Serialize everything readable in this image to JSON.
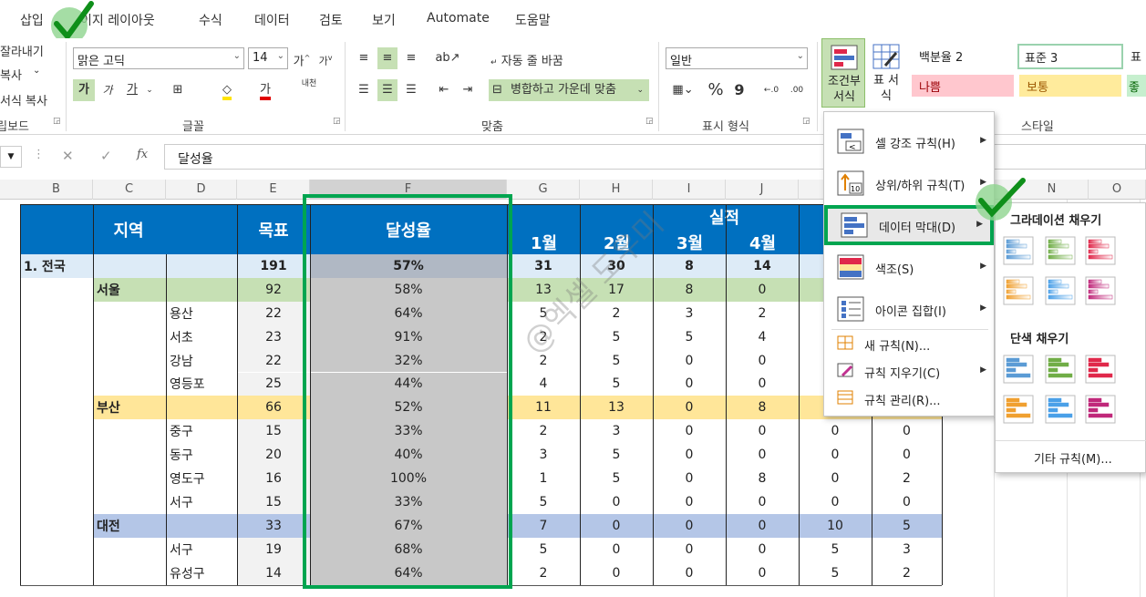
{
  "tabs": [
    "삽입",
    "이지 레이아웃",
    "수식",
    "데이터",
    "검토",
    "보기",
    "Automate",
    "도움말"
  ],
  "clipboard": {
    "cut": "잘라내기",
    "copy": "복사",
    "format_painter": "서식 복사",
    "label": "클립보드"
  },
  "font": {
    "name": "맑은 고딕",
    "size": "14",
    "label": "글꼴",
    "grow": "가",
    "shrink": "가",
    "bold": "가",
    "italic": "가",
    "underline": "가",
    "color": "가",
    "phonetic": "내천"
  },
  "alignment": {
    "wrap": "자동 줄 바꿈",
    "merge": "병합하고 가운데 맞춤",
    "label": "맞춤"
  },
  "number": {
    "format": "일반",
    "label": "표시 형식",
    "percent": "%",
    "comma": "9",
    "inc": "←.0",
    "dec": ".00"
  },
  "styles": {
    "cond_format": "조건부 서식",
    "table_format": "표 서식",
    "label": "스타일",
    "cells": [
      {
        "name": "백분율 2",
        "bg": "#ffffff",
        "color": "#222222"
      },
      {
        "name": "표준 3",
        "bg": "#ffffff",
        "color": "#222222"
      },
      {
        "name": "표",
        "bg": "#ffffff",
        "color": "#222222"
      },
      {
        "name": "나쁨",
        "bg": "#ffc7ce",
        "color": "#9c0006"
      },
      {
        "name": "보통",
        "bg": "#ffeb9c",
        "color": "#9c5700"
      },
      {
        "name": "좋",
        "bg": "#c6efce",
        "color": "#006100"
      }
    ]
  },
  "formula_bar": {
    "cell_ref": "",
    "fx": "fx",
    "content": "달성율"
  },
  "columns": [
    "B",
    "C",
    "D",
    "E",
    "F",
    "G",
    "H",
    "I",
    "J",
    "N",
    "O"
  ],
  "table": {
    "header": {
      "region": "지역",
      "target": "목표",
      "rate": "달성율",
      "actual": "실적",
      "months": [
        "1월",
        "2월",
        "3월",
        "4월"
      ]
    },
    "rows": [
      {
        "type": "total",
        "c1": "1. 전국",
        "c2": "",
        "target": "191",
        "rate": "57%",
        "m": [
          "31",
          "30",
          "8",
          "14"
        ],
        "k": "",
        "l": ""
      },
      {
        "type": "city",
        "c1": "",
        "c2": "서울",
        "target": "92",
        "rate": "58%",
        "m": [
          "13",
          "17",
          "8",
          "0"
        ],
        "k": "",
        "l": ""
      },
      {
        "type": "dist",
        "c1": "",
        "c2": "용산",
        "target": "22",
        "rate": "64%",
        "m": [
          "5",
          "2",
          "3",
          "2"
        ],
        "k": "",
        "l": ""
      },
      {
        "type": "dist",
        "c1": "",
        "c2": "서초",
        "target": "23",
        "rate": "91%",
        "m": [
          "2",
          "5",
          "5",
          "4"
        ],
        "k": "",
        "l": ""
      },
      {
        "type": "dist",
        "c1": "",
        "c2": "강남",
        "target": "22",
        "rate": "32%",
        "m": [
          "2",
          "5",
          "0",
          "0"
        ],
        "k": "",
        "l": ""
      },
      {
        "type": "dist",
        "c1": "",
        "c2": "영등포",
        "target": "25",
        "rate": "44%",
        "m": [
          "4",
          "5",
          "0",
          "0"
        ],
        "k": "",
        "l": ""
      },
      {
        "type": "city2",
        "c1": "",
        "c2": "부산",
        "target": "66",
        "rate": "52%",
        "m": [
          "11",
          "13",
          "0",
          "8"
        ],
        "k": "",
        "l": ""
      },
      {
        "type": "dist",
        "c1": "",
        "c2": "중구",
        "target": "15",
        "rate": "33%",
        "m": [
          "2",
          "3",
          "0",
          "0"
        ],
        "k": "0",
        "l": "0"
      },
      {
        "type": "dist",
        "c1": "",
        "c2": "동구",
        "target": "20",
        "rate": "40%",
        "m": [
          "3",
          "5",
          "0",
          "0"
        ],
        "k": "0",
        "l": "0"
      },
      {
        "type": "dist",
        "c1": "",
        "c2": "영도구",
        "target": "16",
        "rate": "100%",
        "m": [
          "1",
          "5",
          "0",
          "8"
        ],
        "k": "0",
        "l": "2"
      },
      {
        "type": "dist",
        "c1": "",
        "c2": "서구",
        "target": "15",
        "rate": "33%",
        "m": [
          "5",
          "0",
          "0",
          "0"
        ],
        "k": "0",
        "l": "0"
      },
      {
        "type": "city3",
        "c1": "",
        "c2": "대전",
        "target": "33",
        "rate": "67%",
        "m": [
          "7",
          "0",
          "0",
          "0"
        ],
        "k": "10",
        "l": "5"
      },
      {
        "type": "dist",
        "c1": "",
        "c2": "서구",
        "target": "19",
        "rate": "68%",
        "m": [
          "5",
          "0",
          "0",
          "0"
        ],
        "k": "5",
        "l": "3"
      },
      {
        "type": "dist",
        "c1": "",
        "c2": "유성구",
        "target": "14",
        "rate": "64%",
        "m": [
          "2",
          "0",
          "0",
          "0"
        ],
        "k": "5",
        "l": "2"
      }
    ]
  },
  "cf_menu": [
    {
      "label": "셀 강조 규칙(H)",
      "icon": "highlight-rules-icon",
      "sub": true
    },
    {
      "label": "상위/하위 규칙(T)",
      "icon": "top-bottom-icon",
      "sub": true
    },
    {
      "label": "데이터 막대(D)",
      "icon": "data-bars-icon",
      "sub": true,
      "highlight": true
    },
    {
      "label": "색조(S)",
      "icon": "color-scales-icon",
      "sub": true
    },
    {
      "label": "아이콘 집합(I)",
      "icon": "icon-sets-icon",
      "sub": true
    },
    {
      "label": "새 규칙(N)...",
      "icon": "new-rule-icon",
      "sub": false
    },
    {
      "label": "규칙 지우기(C)",
      "icon": "clear-rules-icon",
      "sub": true
    },
    {
      "label": "규칙 관리(R)...",
      "icon": "manage-rules-icon",
      "sub": false
    }
  ],
  "databar_menu": {
    "gradient_title": "그라데이션 채우기",
    "solid_title": "단색 채우기",
    "more": "기타 규칙(M)...",
    "colors": [
      "#5b9bd5",
      "#70ad47",
      "#e0284b",
      "#f0a030",
      "#4aa0e8",
      "#c0287a"
    ]
  },
  "watermark": "@엑셀 도우미",
  "accent": "#00a550"
}
